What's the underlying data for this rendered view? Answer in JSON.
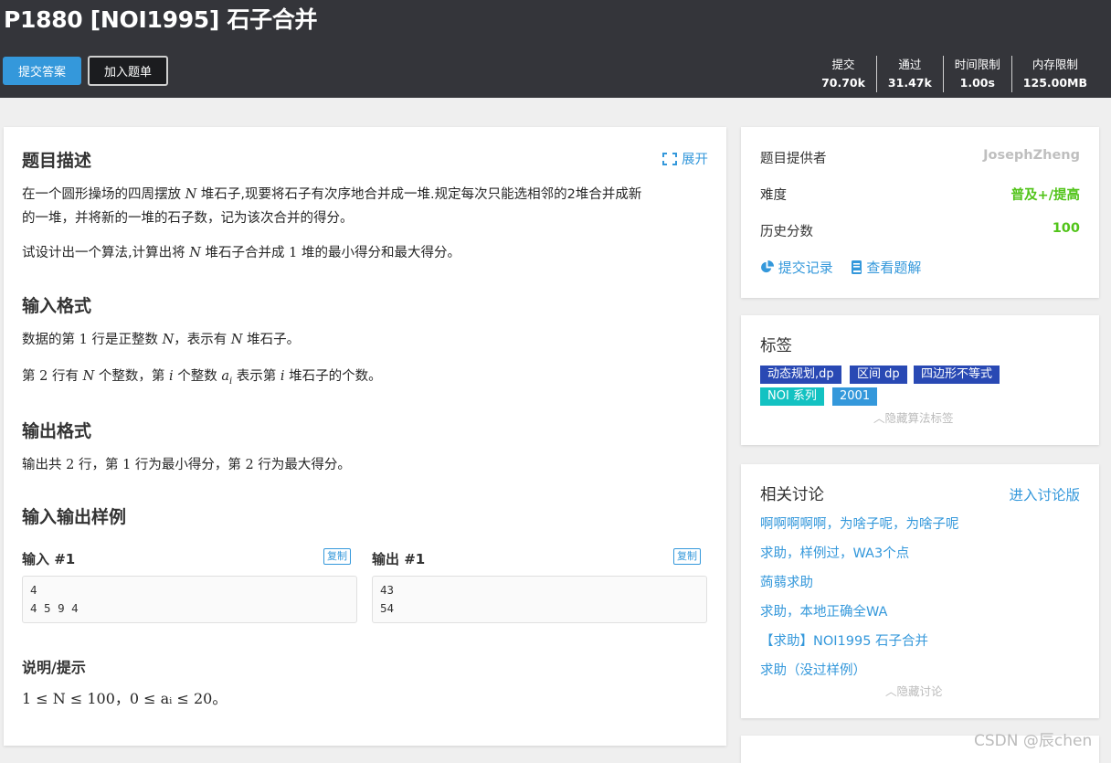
{
  "problem": {
    "title": "P1880 [NOI1995] 石子合并",
    "submit_label": "提交答案",
    "add_label": "加入题单",
    "stats": [
      {
        "label": "提交",
        "value": "70.70k"
      },
      {
        "label": "通过",
        "value": "31.47k"
      },
      {
        "label": "时间限制",
        "value": "1.00s"
      },
      {
        "label": "内存限制",
        "value": "125.00MB"
      }
    ]
  },
  "content": {
    "desc_title": "题目描述",
    "expand_label": "展开",
    "desc_p1a": "在一个圆形操场的四周摆放 ",
    "desc_p1b": " 堆石子,现要将石子有次序地合并成一堆.规定每次只能选相邻的2堆合并成新",
    "desc_p1c": "的一堆，并将新的一堆的石子数，记为该次合并的得分。",
    "desc_p2a": "试设计出一个算法,计算出将 ",
    "desc_p2b": " 堆石子合并成 ",
    "desc_p2c": " 堆的最小得分和最大得分。",
    "var_N": "N",
    "one": "1",
    "two": "2",
    "var_i": "i",
    "var_a": "a",
    "in_title": "输入格式",
    "in_p1a": "数据的第 ",
    "in_p1b": " 行是正整数 ",
    "in_p1c": "，表示有 ",
    "in_p1d": " 堆石子。",
    "in_p2a": "第 ",
    "in_p2b": " 行有 ",
    "in_p2c": " 个整数，第 ",
    "in_p2d": " 个整数 ",
    "in_p2e": " 表示第 ",
    "in_p2f": " 堆石子的个数。",
    "out_title": "输出格式",
    "out_p1a": "输出共 ",
    "out_p1b": " 行，第 ",
    "out_p1c": " 行为最小得分，第 ",
    "out_p1d": " 行为最大得分。",
    "sample_title": "输入输出样例",
    "input_label": "输入 #1",
    "output_label": "输出 #1",
    "copy_label": "复制",
    "input_text": "4\n4 5 9 4",
    "output_text": "43\n54",
    "hint_title": "说明/提示",
    "hint_math": "1 ≤ N ≤ 100，0 ≤ aᵢ ≤ 20。"
  },
  "sidebar": {
    "provider_label": "题目提供者",
    "provider_value": "JosephZheng",
    "difficulty_label": "难度",
    "difficulty_value": "普及+/提高",
    "score_label": "历史分数",
    "score_value": "100",
    "records_label": "提交记录",
    "solutions_label": "查看题解",
    "tags_title": "标签",
    "tags": [
      "动态规划,dp",
      "区间 dp",
      "四边形不等式",
      "NOI 系列",
      "2001"
    ],
    "hide_tags_label": "隐藏算法标签",
    "discuss_title": "相关讨论",
    "discuss_enter": "进入讨论版",
    "discussions": [
      "啊啊啊啊啊，为啥子呢，为啥子呢",
      "求助，样例过，WA3个点",
      "蒟蒻求助",
      "求助，本地正确全WA",
      "【求助】NOI1995 石子合并",
      "求助（没过样例）"
    ],
    "hide_discuss_label": "隐藏讨论"
  },
  "watermark": "CSDN @辰chen",
  "colors": {
    "header_bg": "#34353a",
    "accent": "#3498db",
    "difficulty": "#52c41a",
    "tag_algo": "#2949b4",
    "tag_noi": "#13c2c2"
  }
}
